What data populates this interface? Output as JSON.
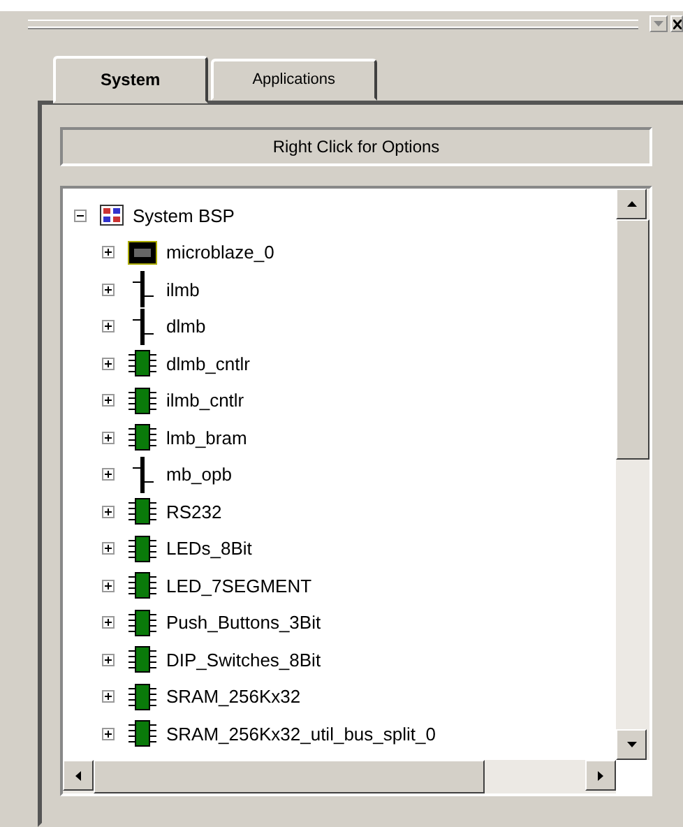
{
  "tabs": [
    {
      "label": "System",
      "selected": true
    },
    {
      "label": "Applications",
      "selected": false
    }
  ],
  "options_bar": {
    "label": "Right Click for Options"
  },
  "tree": [
    {
      "label": "System BSP",
      "kind": "bsp",
      "expanded": true,
      "children": [
        {
          "label": "microblaze_0",
          "kind": "cpu",
          "expanded": false
        },
        {
          "label": "ilmb",
          "kind": "bus",
          "expanded": false
        },
        {
          "label": "dlmb",
          "kind": "bus",
          "expanded": false
        },
        {
          "label": "dlmb_cntlr",
          "kind": "ip",
          "expanded": false
        },
        {
          "label": "ilmb_cntlr",
          "kind": "ip",
          "expanded": false
        },
        {
          "label": "lmb_bram",
          "kind": "ip",
          "expanded": false
        },
        {
          "label": "mb_opb",
          "kind": "bus",
          "expanded": false
        },
        {
          "label": "RS232",
          "kind": "ip",
          "expanded": false
        },
        {
          "label": "LEDs_8Bit",
          "kind": "ip",
          "expanded": false
        },
        {
          "label": "LED_7SEGMENT",
          "kind": "ip",
          "expanded": false
        },
        {
          "label": "Push_Buttons_3Bit",
          "kind": "ip",
          "expanded": false
        },
        {
          "label": "DIP_Switches_8Bit",
          "kind": "ip",
          "expanded": false
        },
        {
          "label": "SRAM_256Kx32",
          "kind": "ip",
          "expanded": false
        },
        {
          "label": "SRAM_256Kx32_util_bus_split_0",
          "kind": "ip",
          "expanded": false
        }
      ]
    }
  ]
}
